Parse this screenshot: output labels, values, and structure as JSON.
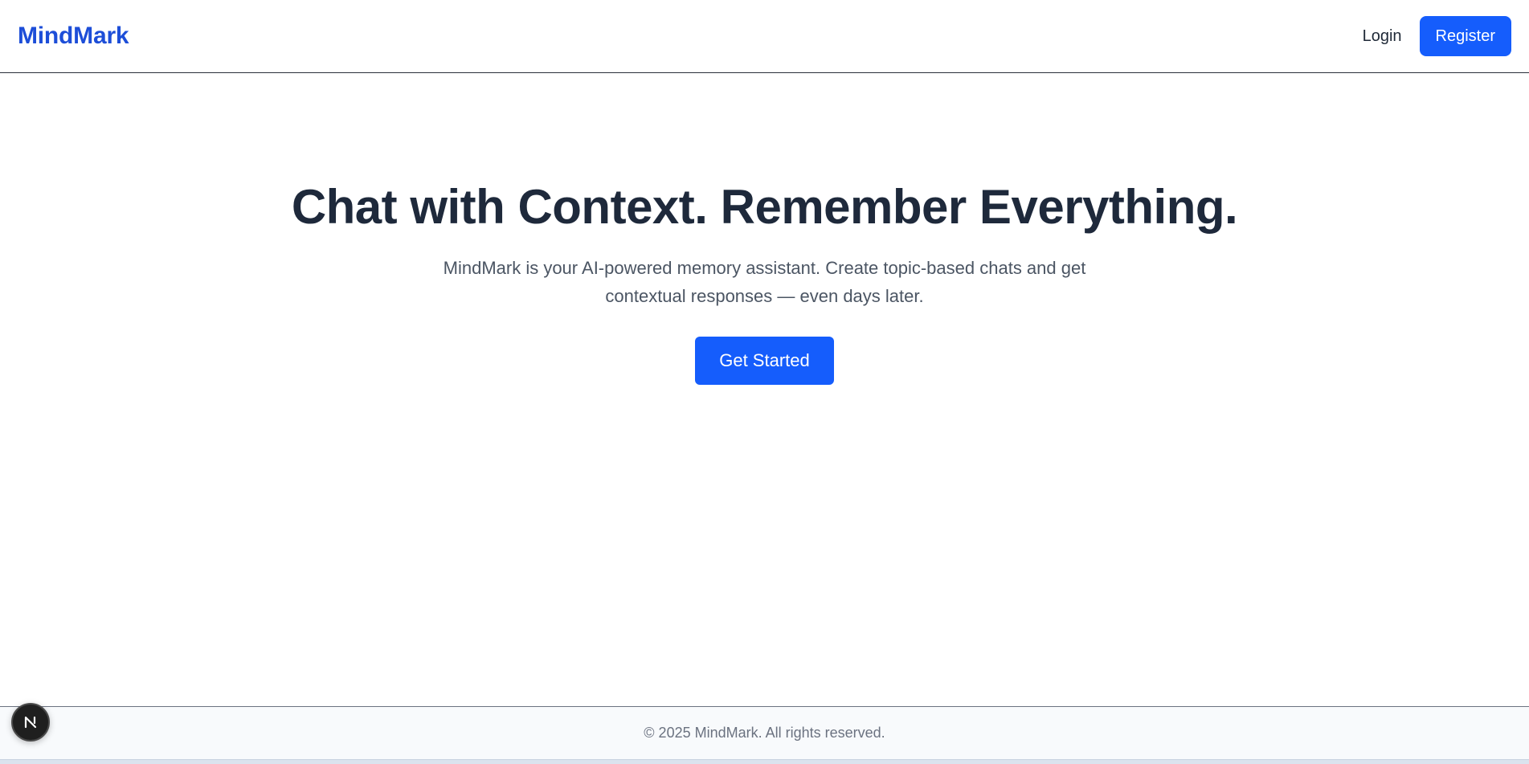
{
  "header": {
    "brand": "MindMark",
    "login_label": "Login",
    "register_label": "Register"
  },
  "hero": {
    "title": "Chat with Context. Remember Everything.",
    "subtitle": "MindMark is your AI-powered memory assistant. Create topic-based chats and get contextual responses — even days later.",
    "cta_label": "Get Started"
  },
  "footer": {
    "copyright": "© 2025 MindMark. All rights reserved."
  },
  "dev_indicator": {
    "icon": "nextjs-logo-icon"
  },
  "colors": {
    "brand": "#1d4ed8",
    "primary_button": "#155dfc",
    "heading": "#1e293b",
    "body_text": "#4b5563",
    "footer_bg": "#f8fafc"
  }
}
